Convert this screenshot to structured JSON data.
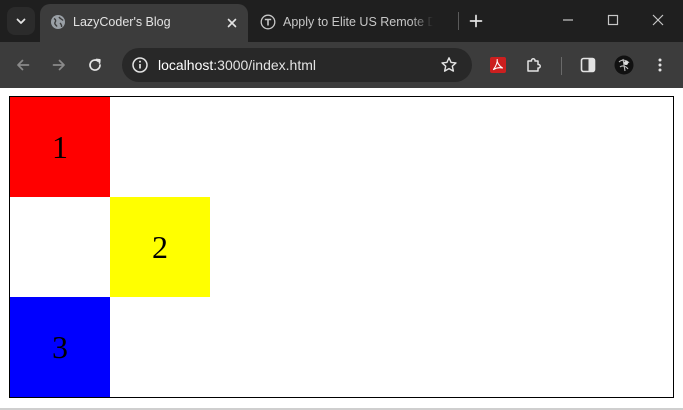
{
  "tabs": [
    {
      "title": "LazyCoder's Blog",
      "active": true,
      "icon": "globe-icon"
    },
    {
      "title": "Apply to Elite US Remote Dev",
      "active": false,
      "icon": "turing-icon"
    }
  ],
  "address_bar": {
    "host": "localhost",
    "path": ":3000/index.html"
  },
  "boxes": [
    {
      "label": "1",
      "color": "#ff0000"
    },
    {
      "label": "2",
      "color": "#ffff00"
    },
    {
      "label": "3",
      "color": "#0000ff"
    }
  ],
  "colors": {
    "browser_dark": "#1f1f1f",
    "toolbar": "#3c3c3c",
    "omnibox": "#282828",
    "pdf_icon": "#cc1f1f"
  }
}
